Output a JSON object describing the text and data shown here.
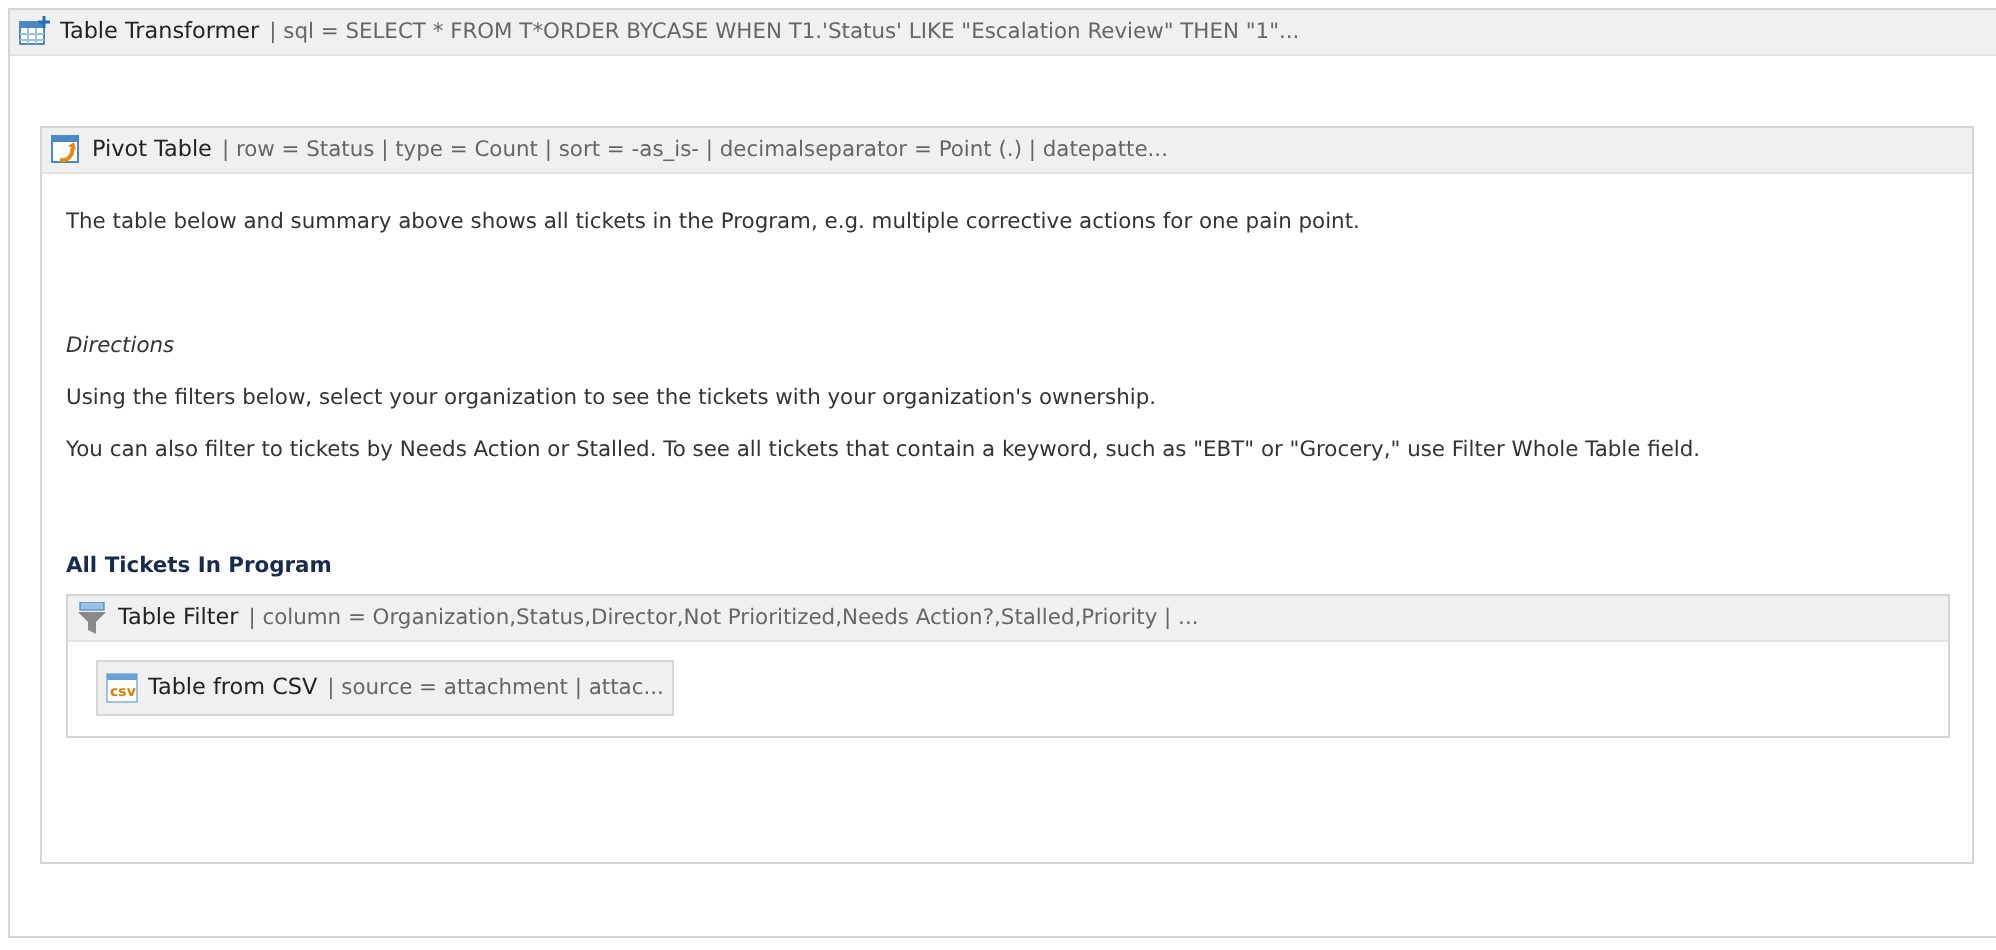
{
  "macro": {
    "kind": "transformer",
    "title": "Table Transformer",
    "params": "| sql = SELECT * FROM T*ORDER BYCASE WHEN T1.'Status' LIKE \"Escalation Review\" THEN \"1\"...",
    "children": [
      {
        "kind": "pivot",
        "title": "Pivot Table",
        "params": "| row = Status | type = Count | sort = -as_is- | decimalseparator = Point (.) | datepatte...",
        "children": [
          {
            "kind": "paragraph",
            "text": "The table below and summary above shows all tickets in the Program, e.g. multiple corrective actions for one pain point."
          },
          {
            "kind": "gap"
          },
          {
            "kind": "italic",
            "text": "Directions"
          },
          {
            "kind": "paragraph",
            "text": "Using the filters below, select your organization to see the tickets with your organization's ownership."
          },
          {
            "kind": "paragraph",
            "text": "You can also filter to tickets by Needs Action or Stalled. To see all tickets that contain a keyword, such as \"EBT\" or \"Grocery,\" use Filter Whole Table field."
          },
          {
            "kind": "gap"
          },
          {
            "kind": "bold",
            "text": "All Tickets In Program"
          },
          {
            "kind": "filter",
            "title": "Table Filter",
            "params": "| column = Organization,Status,Director,Not Prioritized,Needs Action?,Stalled,Priority | ...",
            "children": [
              {
                "kind": "csv",
                "icon_label": "csv",
                "title": "Table from CSV",
                "params": "| source = attachment | attac..."
              }
            ]
          }
        ]
      }
    ]
  }
}
